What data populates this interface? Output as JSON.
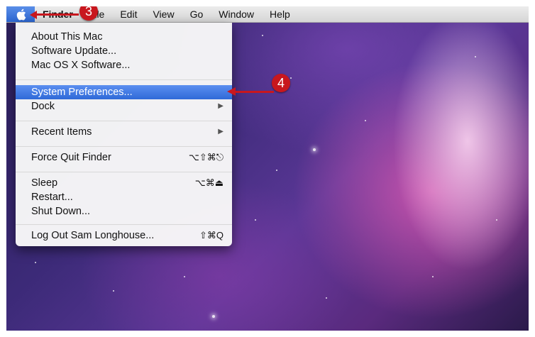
{
  "menubar": {
    "app_name": "Finder",
    "items": [
      "File",
      "Edit",
      "View",
      "Go",
      "Window",
      "Help"
    ]
  },
  "apple_menu": {
    "items": [
      {
        "label": "About This Mac"
      },
      {
        "label": "Software Update..."
      },
      {
        "label": "Mac OS X Software..."
      },
      {
        "label": "System Preferences...",
        "selected": true
      },
      {
        "label": "Dock",
        "submenu": true
      },
      {
        "label": "Recent Items",
        "submenu": true
      },
      {
        "label": "Force Quit Finder",
        "shortcut": "⌥⇧⌘⎋"
      },
      {
        "label": "Sleep",
        "shortcut": "⌥⌘⏏"
      },
      {
        "label": "Restart..."
      },
      {
        "label": "Shut Down..."
      },
      {
        "label": "Log Out Sam Longhouse...",
        "shortcut": "⇧⌘Q"
      }
    ]
  },
  "callouts": {
    "step3": "3",
    "step4": "4"
  },
  "colors": {
    "highlight": "#2f69d8",
    "callout": "#c8171e"
  }
}
